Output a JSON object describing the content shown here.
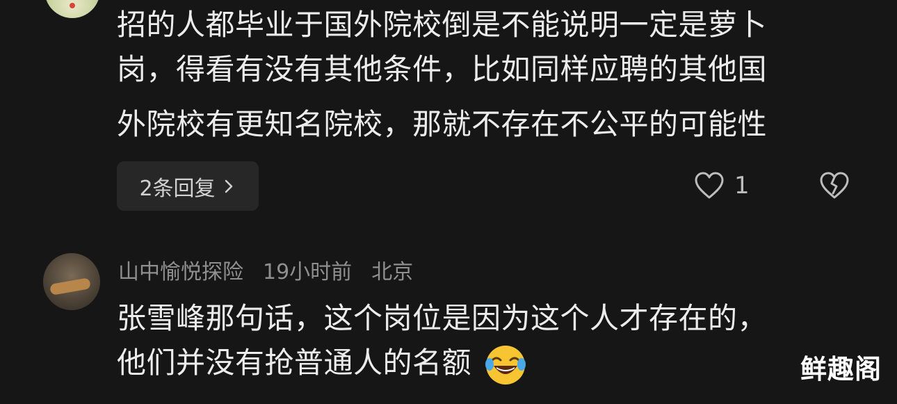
{
  "comment1": {
    "lines": [
      "招的人都毕业于国外院校倒是不能说明一定是萝卜",
      "岗，得看有没有其他条件，比如同样应聘的其他国",
      "外院校有更知名院校，那就不存在不公平的可能性"
    ],
    "reply_button_label": "2条回复",
    "like_count": "1",
    "icons": {
      "like": "heart-outline-icon",
      "dislike": "broken-heart-icon",
      "chevron": "chevron-right-icon"
    }
  },
  "comment2": {
    "username": "山中愉悦探险",
    "time": "19小时前",
    "location": "北京",
    "lines": [
      "张雪峰那句话，这个岗位是因为这个人才存在的，",
      "他们并没有抢普通人的名额"
    ],
    "emoji": "laughing-crying-emoji"
  },
  "watermark": "鲜趣阁",
  "colors": {
    "background": "#161616",
    "text": "#ececec",
    "meta": "#8f8f8f",
    "pill": "#272727"
  }
}
